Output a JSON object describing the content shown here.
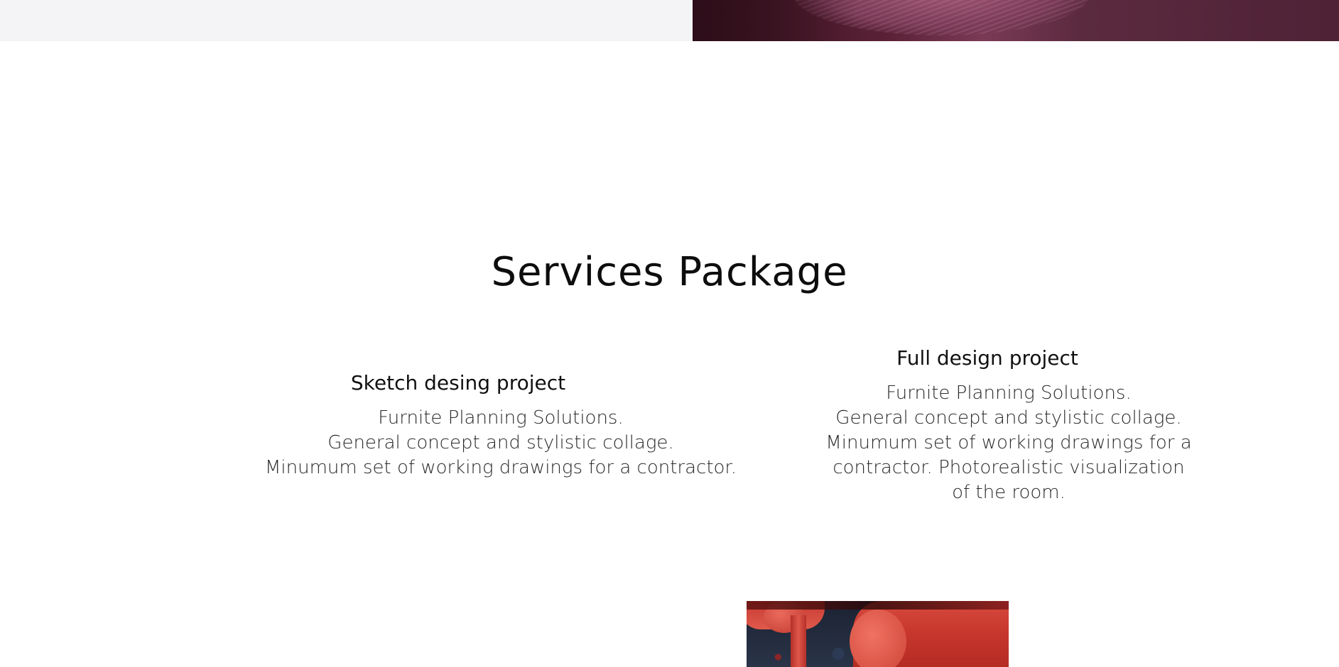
{
  "section": {
    "title": "Services Package"
  },
  "services": [
    {
      "title": "Sketch desing project",
      "description_lines": [
        "Furnite Planning Solutions.",
        "General concept and stylistic collage.",
        "Minumum set of working drawings for a contractor."
      ]
    },
    {
      "title": "Full design project",
      "description_lines": [
        "Furnite Planning Solutions.",
        "General concept and stylistic collage.",
        "Minumum set of working drawings for a",
        "contractor. Photorealistic visualization",
        "of the room."
      ]
    }
  ],
  "colors": {
    "top_left_panel": "#f4f4f6",
    "top_image_tone": "#5a2136",
    "bottom_image_accent": "#d74a3e",
    "text": "#111111"
  }
}
